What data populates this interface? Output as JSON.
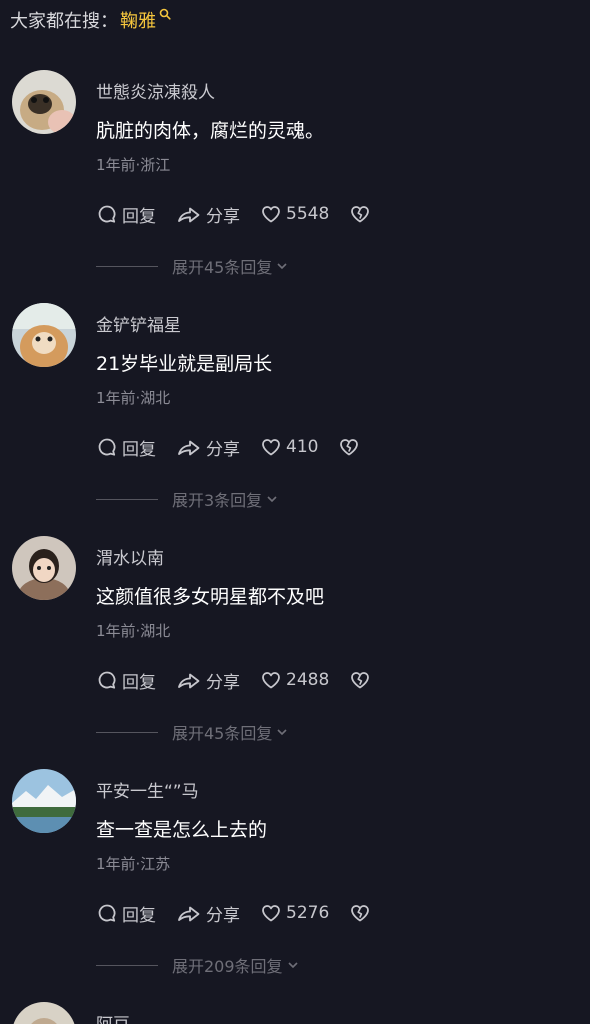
{
  "search_hint": {
    "prefix": "大家都在搜：",
    "keyword": "鞠雅"
  },
  "actions": {
    "reply": "回复",
    "share": "分享"
  },
  "comments": [
    {
      "username": "世態炎涼凍殺人",
      "text": "肮脏的肉体，腐烂的灵魂。",
      "meta": "1年前·浙江",
      "likes": "5548",
      "expand": "展开45条回复"
    },
    {
      "username": "金铲铲福星",
      "text": "21岁毕业就是副局长",
      "meta": "1年前·湖北",
      "likes": "410",
      "expand": "展开3条回复"
    },
    {
      "username": "渭水以南",
      "text": "这颜值很多女明星都不及吧",
      "meta": "1年前·湖北",
      "likes": "2488",
      "expand": "展开45条回复"
    },
    {
      "username": "平安一生“”马",
      "text": "查一查是怎么上去的",
      "meta": "1年前·江苏",
      "likes": "5276",
      "expand": "展开209条回复"
    },
    {
      "username": "阿豆"
    }
  ]
}
